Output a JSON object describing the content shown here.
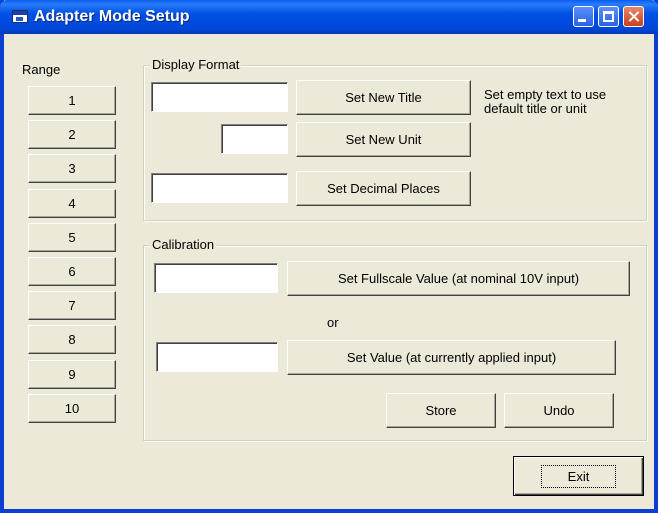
{
  "window": {
    "title": "Adapter Mode Setup"
  },
  "range": {
    "label": "Range",
    "buttons": [
      "1",
      "2",
      "3",
      "4",
      "5",
      "6",
      "7",
      "8",
      "9",
      "10"
    ]
  },
  "display_format": {
    "label": "Display Format",
    "title_value": "",
    "unit_value": "",
    "decimal_value": "",
    "set_title_label": "Set New Title",
    "set_unit_label": "Set New Unit",
    "set_decimal_label": "Set Decimal Places",
    "hint_line1": "Set empty text to use",
    "hint_line2": "default title or unit"
  },
  "calibration": {
    "label": "Calibration",
    "fullscale_value": "",
    "value_value": "",
    "set_fullscale_label": "Set Fullscale Value (at nominal 10V input)",
    "or_label": "or",
    "set_value_label": "Set Value (at currently applied input)",
    "store_label": "Store",
    "undo_label": "Undo"
  },
  "exit_label": "Exit"
}
